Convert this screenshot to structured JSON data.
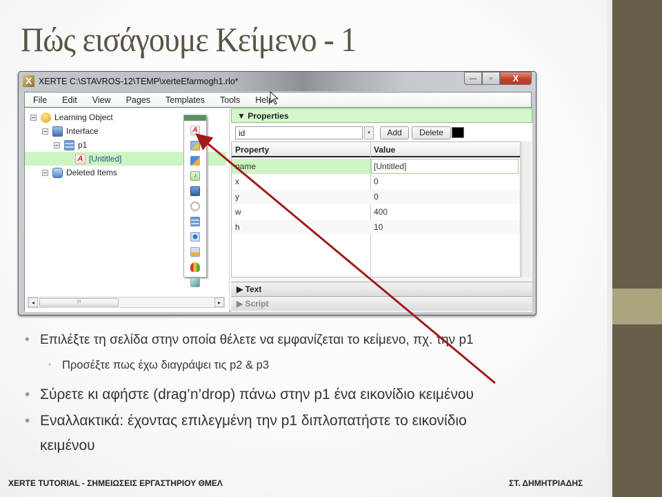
{
  "slide": {
    "title": "Πώς εισάγουμε Κείμενο  -  1",
    "accent_color": "#675e48",
    "accent_band_color": "#a8a47e"
  },
  "window": {
    "icon": "X",
    "title": "XERTE C:\\STAVROS-12\\TEMP\\xerteEfarmogh1.rlo*",
    "buttons": {
      "minimize": "—",
      "maximize": "▫",
      "close": "X"
    }
  },
  "menu": [
    "File",
    "Edit",
    "View",
    "Pages",
    "Templates",
    "Tools",
    "Help"
  ],
  "tree": {
    "items": [
      {
        "label": "Learning Object",
        "icon": "learning-object-icon",
        "level": 0
      },
      {
        "label": "Interface",
        "icon": "interface-icon",
        "level": 1
      },
      {
        "label": "p1",
        "icon": "page-icon",
        "level": 2
      },
      {
        "label": "[Untitled]",
        "icon": "text-icon",
        "level": 3,
        "selected": true
      },
      {
        "label": "Deleted Items",
        "icon": "deleted-items-icon",
        "level": 1
      }
    ],
    "scroll_thumb": "III",
    "scroll_left": "◂",
    "scroll_right": "▸"
  },
  "palette": {
    "icons": [
      "text-icon",
      "image-text-icon",
      "edit-pencil-icon",
      "audio-icon",
      "video-monitor-icon",
      "link-chain-icon",
      "page-layout-icon",
      "button-icon",
      "timeline-icon",
      "chart-icon",
      "table-icon"
    ]
  },
  "properties": {
    "header": "▼ Properties",
    "id_value": "id",
    "dropdown_glyph": "▾",
    "add_label": "Add",
    "delete_label": "Delete",
    "color_value": "#000000",
    "columns": [
      "Property",
      "Value"
    ],
    "rows": [
      {
        "property": "name",
        "value": "[Untitled]",
        "selected": true
      },
      {
        "property": "x",
        "value": "0"
      },
      {
        "property": "y",
        "value": "0"
      },
      {
        "property": "w",
        "value": "400"
      },
      {
        "property": "h",
        "value": "10"
      }
    ],
    "sections": [
      {
        "label": "▶ Text",
        "enabled": true
      },
      {
        "label": "▶ Script",
        "enabled": false
      }
    ]
  },
  "bullets": [
    {
      "level": 1,
      "text": "Επιλέξτε τη σελίδα στην οποία θέλετε να εμφανίζεται το κείμενο, πχ. την p1"
    },
    {
      "level": 2,
      "text": "Προσέξτε πως έχω διαγράψει τις p2 & p3"
    },
    {
      "level": 1,
      "text": "Σύρετε κι αφήστε (drag’n’drop) πάνω στην p1 ένα εικονίδιο κειμένου"
    },
    {
      "level": 1,
      "text": "Εναλλακτικά: έχοντας επιλεγμένη την p1 διπλοπατήστε το εικονίδιο"
    },
    {
      "level": 1,
      "text": "κειμένου",
      "continuation": true
    }
  ],
  "bullet_glyph": "•",
  "footer": {
    "left": "XERTE TUTORIAL  -  ΣΗΜΕΙΩΣΕΙΣ ΕΡΓΑΣΤΗΡΙΟΥ ΘΜΕΛ",
    "right": "ΣΤ. ΔΗΜΗΤΡΙΑΔΗΣ"
  },
  "annotation": {
    "type": "arrow",
    "color": "#a31818",
    "meaning": "points from bullet text to text icon in palette"
  }
}
